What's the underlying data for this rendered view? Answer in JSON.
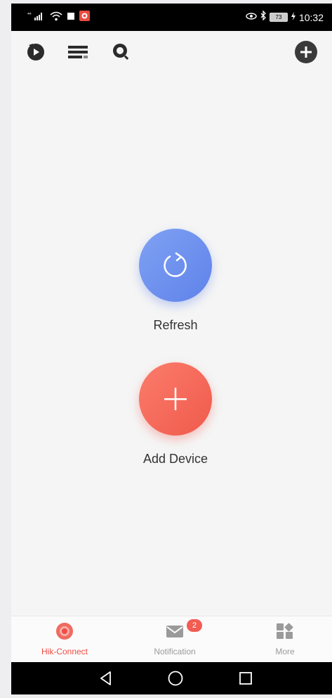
{
  "status_bar": {
    "time": "10:32",
    "battery": "73",
    "signal_text": "⁴⁶"
  },
  "toolbar": {
    "icons": [
      "play-icon",
      "list-icon",
      "search-icon",
      "add-icon"
    ]
  },
  "main": {
    "refresh_label": "Refresh",
    "add_device_label": "Add Device"
  },
  "bottom_nav": {
    "items": [
      {
        "label": "Hik-Connect",
        "icon": "hik-connect-icon",
        "active": true
      },
      {
        "label": "Notification",
        "icon": "mail-icon",
        "badge": "2"
      },
      {
        "label": "More",
        "icon": "grid-icon"
      }
    ]
  },
  "colors": {
    "accent_red": "#ef4d45",
    "refresh_blue": "#6d90ef",
    "add_red": "#f46b5c"
  }
}
